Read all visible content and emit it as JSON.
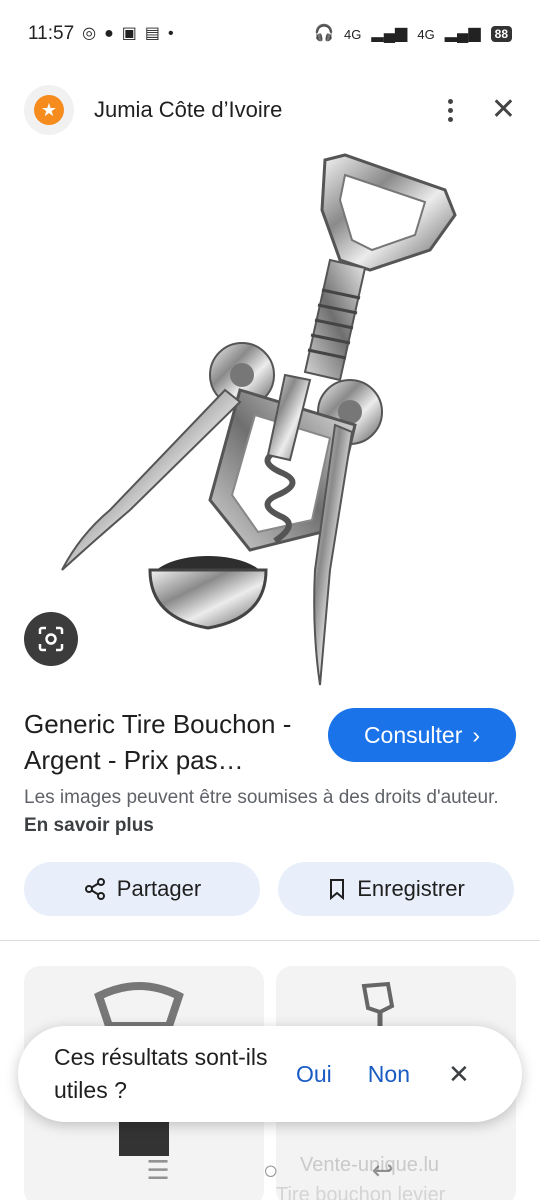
{
  "status_bar": {
    "time": "11:57",
    "network_1": "4G",
    "network_2": "4G",
    "battery": "88"
  },
  "header": {
    "title": "Jumia Côte d’Ivoire"
  },
  "result": {
    "title": "Generic Tire Bouchon - Argent - Prix pas…",
    "visit_label": "Consulter",
    "rights_text": "Les images peuvent être soumises à des droits d'auteur.",
    "learn_more": "En savoir plus"
  },
  "actions": {
    "share_label": "Partager",
    "save_label": "Enregistrer"
  },
  "related": {
    "source_text": "Vente-unique.lu",
    "caption_text": "Tire bouchon levier"
  },
  "feedback": {
    "question": "Ces résultats sont-ils utiles ?",
    "yes_label": "Oui",
    "no_label": "Non"
  },
  "colors": {
    "accent": "#1a73e8",
    "chip_bg": "#e8effa",
    "logo_orange": "#f68b1e"
  }
}
